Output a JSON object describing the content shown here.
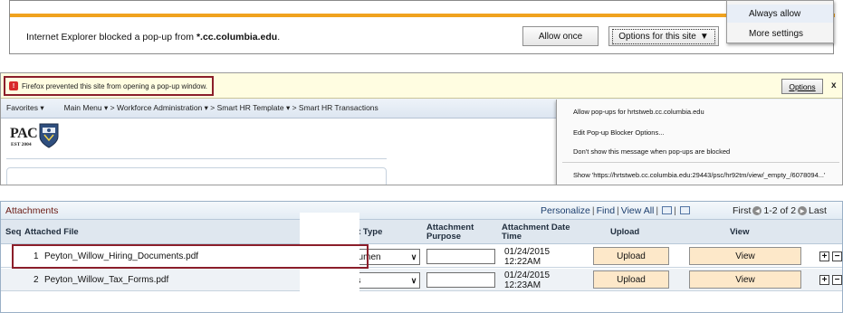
{
  "ie_bar": {
    "message_prefix": "Internet Explorer blocked a pop-up from ",
    "message_site": "*.cc.columbia.edu",
    "message_suffix": ".",
    "allow_once_label": "Allow once",
    "options_label": "Options for this site",
    "dropdown": [
      "Always allow",
      "More settings"
    ],
    "accent_color": "#f0a21e"
  },
  "firefox_bar": {
    "message": "Firefox prevented this site from opening a pop-up window.",
    "options_label": "Options",
    "close_label": "x",
    "favorites_label": "Favorites ▾",
    "breadcrumb": "Main Menu ▾  >  Workforce Administration  ▾  >  Smart HR Template  ▾  >  Smart HR Transactions",
    "logo_text": "PAC",
    "logo_est": "EST 2004",
    "menu": [
      "Allow pop-ups for hrtstweb.cc.columbia.edu",
      "Edit Pop-up Blocker Options...",
      "Don't show this message when pop-ups are blocked",
      "Show 'https://hrtstweb.cc.columbia.edu:29443/psc/hr92tm/view/_empty_/6078094...'"
    ]
  },
  "attachments": {
    "title": "Attachments",
    "toolbar": {
      "personalize": "Personalize",
      "find": "Find",
      "view_all": "View All",
      "first": "First",
      "range": "1-2 of 2",
      "last": "Last"
    },
    "columns": {
      "seq": "Seq",
      "file": "Attached File",
      "type": "ent Type",
      "purpose": "Attachment Purpose",
      "date": "Attachment Date Time",
      "upload": "Upload",
      "view": "View"
    },
    "rows": [
      {
        "seq": "1",
        "file": "Peyton_Willow_Hiring_Documents.pdf",
        "type": "ocumen",
        "date": "01/24/2015",
        "time": "12:22AM",
        "upload": "Upload",
        "view": "View"
      },
      {
        "seq": "2",
        "file": "Peyton_Willow_Tax_Forms.pdf",
        "type": "ms",
        "date": "01/24/2015",
        "time": "12:23AM",
        "upload": "Upload",
        "view": "View"
      }
    ],
    "highlight_color": "#8b1e2a"
  }
}
